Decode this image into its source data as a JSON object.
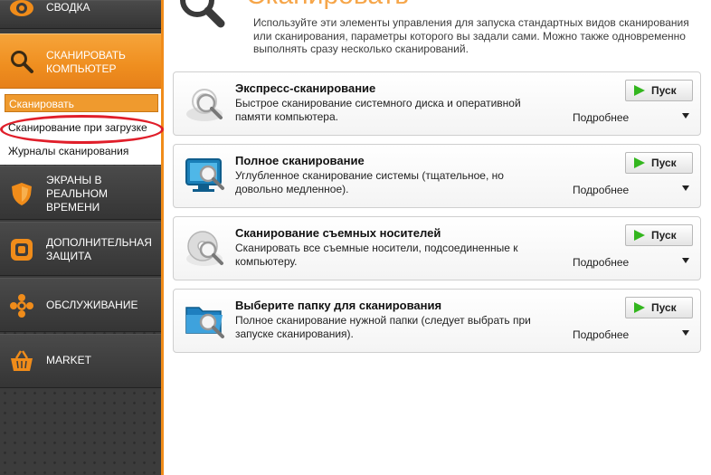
{
  "sidebar": {
    "summary": {
      "label": "СВОДКА",
      "icon": "eye-icon"
    },
    "scan_computer": {
      "label": "СКАНИРОВАТЬ КОМПЬЮТЕР",
      "icon": "magnifier-icon"
    },
    "subitems": [
      {
        "label": "Сканировать"
      },
      {
        "label": "Сканирование при загрузке"
      },
      {
        "label": "Журналы сканирования"
      }
    ],
    "shields": {
      "label": "ЭКРАНЫ В РЕАЛЬНОМ ВРЕМЕНИ",
      "icon": "shield-icon"
    },
    "protection": {
      "label": "ДОПОЛНИТЕЛЬНАЯ ЗАЩИТА",
      "icon": "square-icon"
    },
    "maintenance": {
      "label": "ОБСЛУЖИВАНИЕ",
      "icon": "gear-icon"
    },
    "market": {
      "label": "MARKET",
      "icon": "basket-icon"
    },
    "accent_color": "#f08c1a",
    "annotation_color": "#e01e2a"
  },
  "header": {
    "title": "Сканировать",
    "description": "Используйте эти элементы управления для запуска стандартных видов сканирования или сканирования, параметры которого вы задали сами. Можно также одновременно выполнять сразу несколько сканирований."
  },
  "scans": [
    {
      "title": "Экспресс-сканирование",
      "description": "Быстрое сканирование системного диска и оперативной памяти компьютера.",
      "button": "Пуск",
      "more": "Подробнее",
      "icon": "quick-scan-icon"
    },
    {
      "title": "Полное сканирование",
      "description": "Углубленное сканирование системы (тщательное, но довольно медленное).",
      "button": "Пуск",
      "more": "Подробнее",
      "icon": "monitor-scan-icon"
    },
    {
      "title": "Сканирование съемных носителей",
      "description": "Сканировать все съемные носители, подсоединенные к компьютеру.",
      "button": "Пуск",
      "more": "Подробнее",
      "icon": "disc-scan-icon"
    },
    {
      "title": "Выберите папку для сканирования",
      "description": "Полное сканирование нужной папки (следует выбрать при запуске сканирования).",
      "button": "Пуск",
      "more": "Подробнее",
      "icon": "folder-scan-icon"
    }
  ]
}
